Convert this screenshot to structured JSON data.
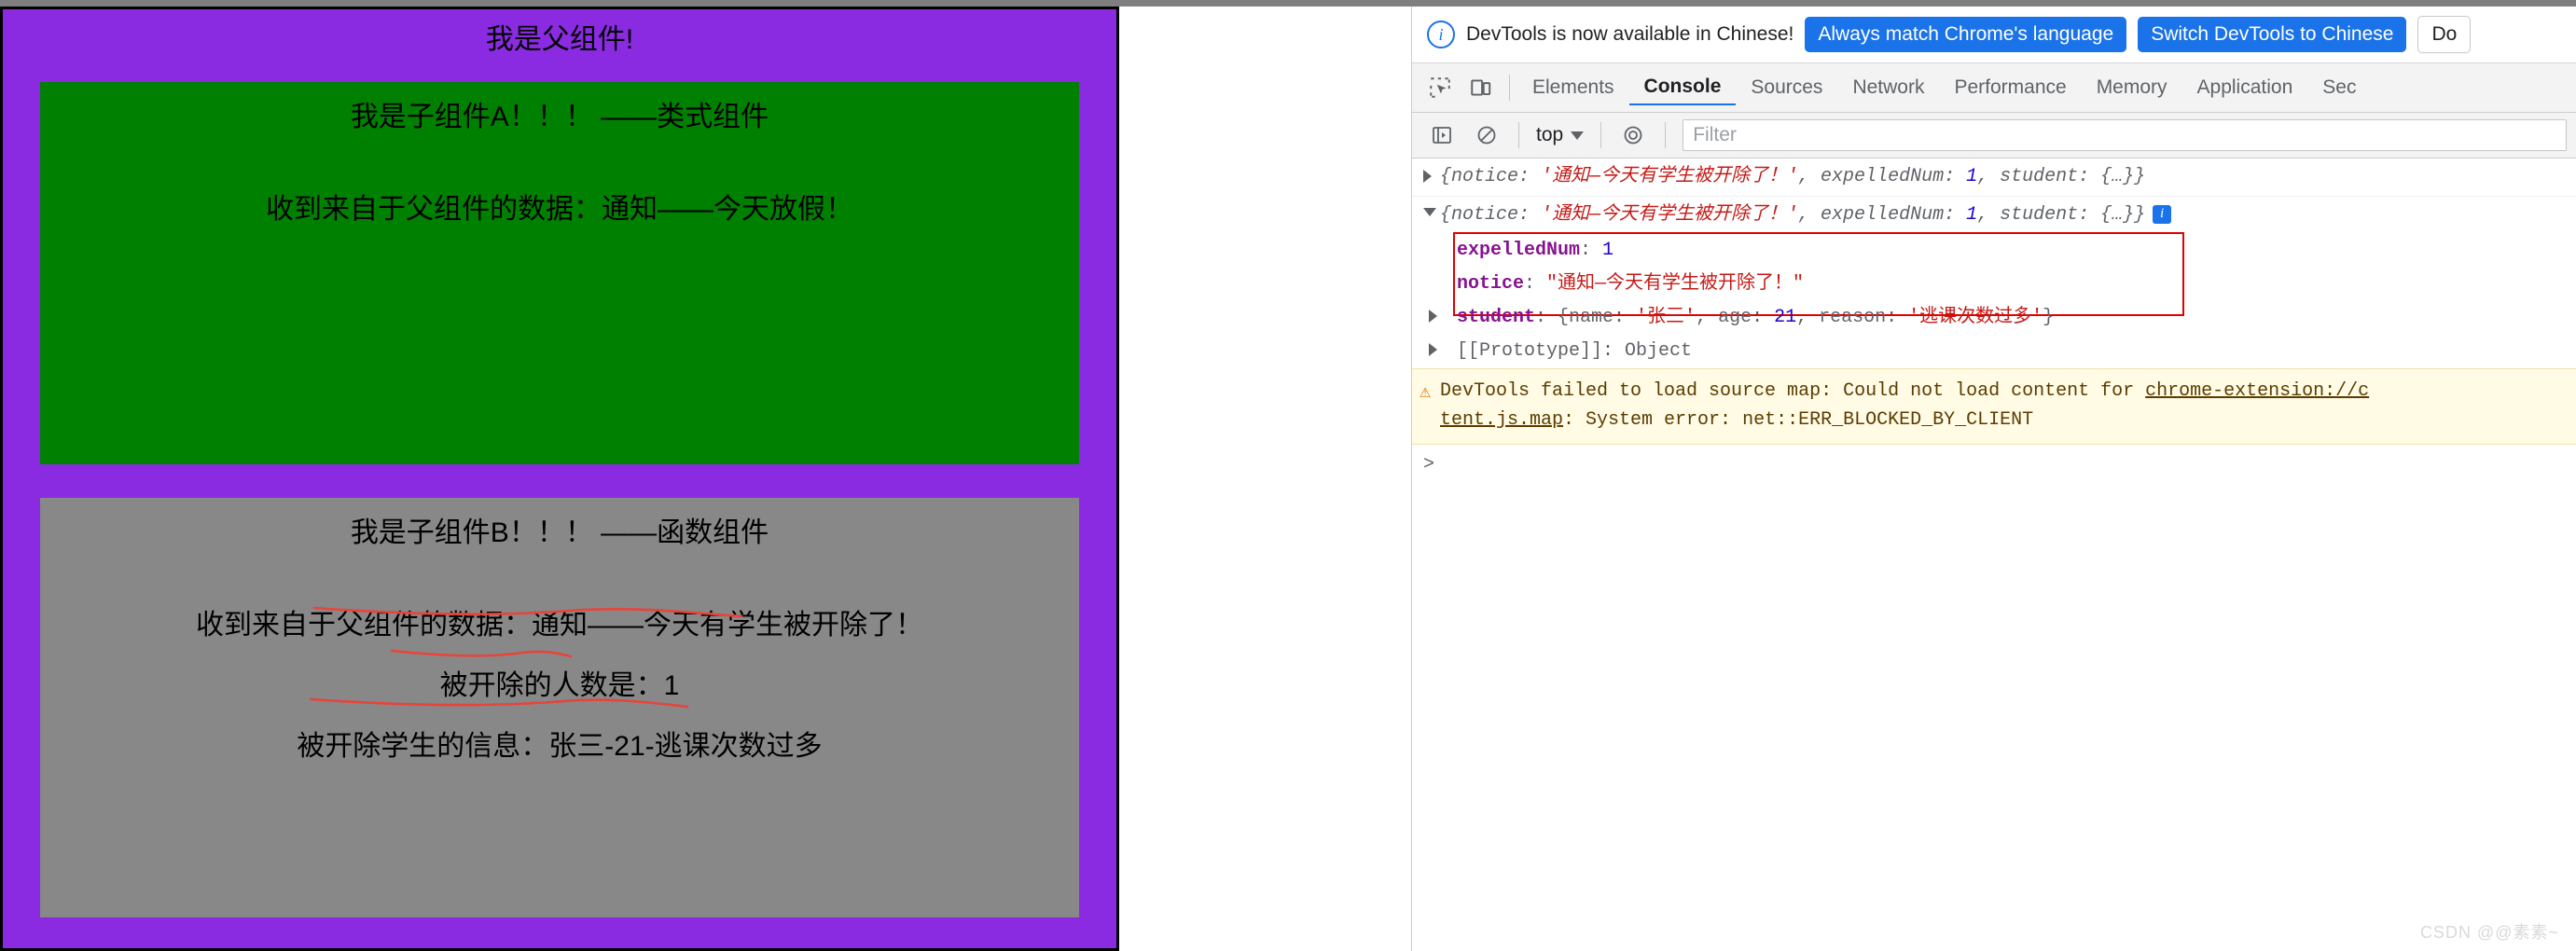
{
  "page": {
    "parent": {
      "title": "我是父组件!",
      "bg_color": "#8a2be2"
    },
    "child_a": {
      "title": "我是子组件A！！！ ——类式组件",
      "received": "收到来自于父组件的数据：通知——今天放假！",
      "bg_color": "#008000"
    },
    "child_b": {
      "title": "我是子组件B！！！ ——函数组件",
      "received": "收到来自于父组件的数据：通知——今天有学生被开除了！",
      "expelled_count": "被开除的人数是：1",
      "student_info": "被开除学生的信息：张三-21-逃课次数过多",
      "bg_color": "#888888"
    }
  },
  "devtools": {
    "banner": {
      "message": "DevTools is now available in Chinese!",
      "always_match_label": "Always match Chrome's language",
      "switch_label": "Switch DevTools to Chinese",
      "dont_show_label": "Do",
      "info_icon": "info-icon"
    },
    "tabs": [
      {
        "label": "Elements",
        "active": false
      },
      {
        "label": "Console",
        "active": true
      },
      {
        "label": "Sources",
        "active": false
      },
      {
        "label": "Network",
        "active": false
      },
      {
        "label": "Performance",
        "active": false
      },
      {
        "label": "Memory",
        "active": false
      },
      {
        "label": "Application",
        "active": false
      },
      {
        "label": "Sec",
        "active": false
      }
    ],
    "console_toolbar": {
      "context": "top",
      "filter_placeholder": "Filter"
    },
    "console": {
      "log1": {
        "prefix": "{notice: ",
        "notice_value": "'通知—今天有学生被开除了！'",
        "mid": ", expelledNum: ",
        "num": "1",
        "suffix": ", student: {…}}"
      },
      "log2": {
        "prefix": "{notice: ",
        "notice_value": "'通知—今天有学生被开除了！'",
        "mid": ", expelledNum: ",
        "num": "1",
        "suffix": ", student: {…}}"
      },
      "expanded": {
        "expelledNum_key": "expelledNum",
        "expelledNum_val": "1",
        "notice_key": "notice",
        "notice_val": "\"通知—今天有学生被开除了！\"",
        "student_key": "student",
        "student_open": "{name: ",
        "student_name": "'张三'",
        "student_age_key": ", age: ",
        "student_age": "21",
        "student_reason_key": ", reason: ",
        "student_reason": "'逃课次数过多'",
        "student_close": "}",
        "prototype": "[[Prototype]]: Object"
      },
      "warning": {
        "line1_a": "DevTools failed to load source map: Could not load content for ",
        "line1_link": "chrome-extension://c",
        "line2_link": "tent.js.map",
        "line2_b": ": System error: net::ERR_BLOCKED_BY_CLIENT"
      },
      "prompt": ">"
    }
  },
  "watermark": "CSDN @@素素~"
}
